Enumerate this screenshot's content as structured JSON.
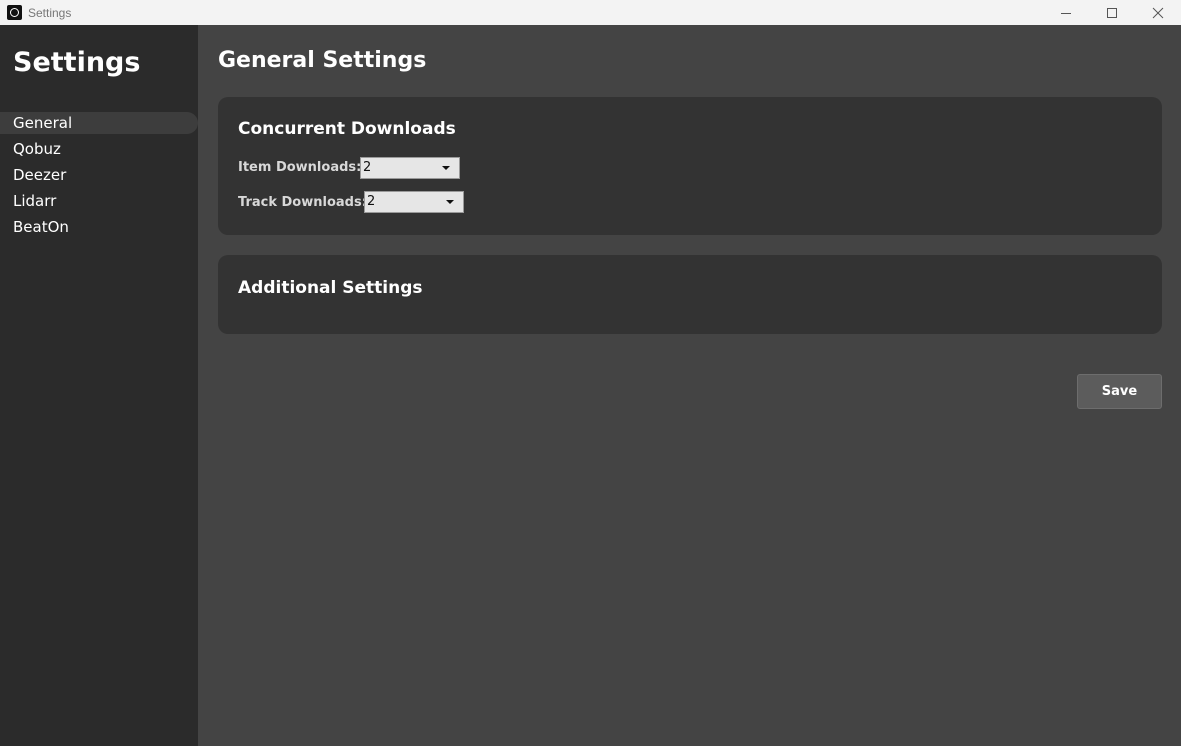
{
  "window": {
    "title": "Settings",
    "icon": "app-logo-icon",
    "controls": [
      "minimize-icon",
      "maximize-icon",
      "close-icon"
    ]
  },
  "sidebar": {
    "title": "Settings",
    "items": [
      {
        "label": "General",
        "active": true
      },
      {
        "label": "Qobuz",
        "active": false
      },
      {
        "label": "Deezer",
        "active": false
      },
      {
        "label": "Lidarr",
        "active": false
      },
      {
        "label": "BeatOn",
        "active": false
      }
    ]
  },
  "main": {
    "title": "General Settings",
    "concurrent": {
      "title": "Concurrent Downloads",
      "item_downloads": {
        "label": "Item Downloads:",
        "value": "2"
      },
      "track_downloads": {
        "label": "Track Downloads:",
        "value": "2"
      }
    },
    "additional": {
      "title": "Additional Settings"
    },
    "save_label": "Save"
  },
  "colors": {
    "sidebar_bg": "#2b2b2b",
    "main_bg": "#444444",
    "card_bg": "#333333",
    "active_item_bg": "#3d3d3d",
    "button_bg": "#5c5c5c"
  }
}
